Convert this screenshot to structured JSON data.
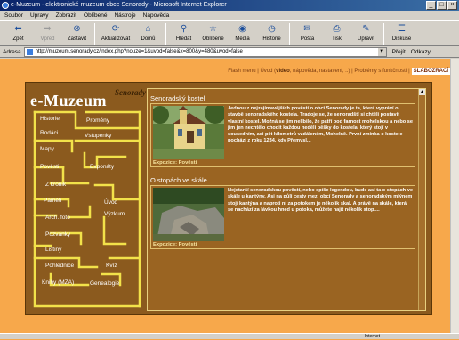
{
  "window": {
    "title": "e-Muzeum - elektronické muzeum obce Senorady - Microsoft Internet Explorer",
    "buttons": [
      "_",
      "□",
      "×"
    ]
  },
  "menu": [
    "Soubor",
    "Úpravy",
    "Zobrazit",
    "Oblíbené",
    "Nástroje",
    "Nápověda"
  ],
  "toolbar": [
    {
      "label": "Zpět",
      "icon": "back-arrow-icon",
      "glyph": "⬅",
      "enabled": true
    },
    {
      "label": "Vpřed",
      "icon": "forward-arrow-icon",
      "glyph": "➡",
      "enabled": false
    },
    {
      "label": "Zastavit",
      "icon": "stop-icon",
      "glyph": "⊗",
      "enabled": true
    },
    {
      "label": "Aktualizovat",
      "icon": "refresh-icon",
      "glyph": "⟳",
      "enabled": true
    },
    {
      "label": "Domů",
      "icon": "home-icon",
      "glyph": "⌂",
      "enabled": true
    },
    {
      "label": "Hledat",
      "icon": "search-icon",
      "glyph": "⚲",
      "enabled": true
    },
    {
      "label": "Oblíbené",
      "icon": "favorites-icon",
      "glyph": "☆",
      "enabled": true
    },
    {
      "label": "Média",
      "icon": "media-icon",
      "glyph": "◉",
      "enabled": true
    },
    {
      "label": "Historie",
      "icon": "history-icon",
      "glyph": "◷",
      "enabled": true
    },
    {
      "label": "Pošta",
      "icon": "mail-icon",
      "glyph": "✉",
      "enabled": true
    },
    {
      "label": "Tisk",
      "icon": "print-icon",
      "glyph": "⎙",
      "enabled": true
    },
    {
      "label": "Upravit",
      "icon": "edit-icon",
      "glyph": "✎",
      "enabled": true
    },
    {
      "label": "Diskuse",
      "icon": "discuss-icon",
      "glyph": "☰",
      "enabled": true
    }
  ],
  "address": {
    "label": "Adresa",
    "url": "http://muzeum.senorady.cz/index.php?nouze=1&uvod=false&x=800&y=480&uvod=false",
    "go": "Přejít",
    "links": "Odkazy"
  },
  "site": {
    "flash_menu": {
      "prefix": "Flash menu | Úvod (",
      "video": "video",
      "suffix": ", nápověda, nastavení, ..) | Problémy s funkčností |",
      "button": "SLABOZRACÍ"
    },
    "logo": "e-Muzeum",
    "logo_sub": "Senorady",
    "menu": [
      "Historie",
      "Proměny",
      "Rodáci",
      "Vstupenky",
      "Mapy",
      "Pověsti",
      "Exponáty",
      "Z kronik",
      "Paměti",
      "Úvod",
      "Arch. foto",
      "Výzkum",
      "Pozvánky",
      "Listiny",
      "Pohlednice",
      "Kvíz",
      "Knihy (MZA)",
      "Genealogie"
    ],
    "stories": [
      {
        "title": "Senoradský kostel",
        "text": "Jednou z nejzajímavějších pověstí o obci Senorady je ta, která vypráví o stavbě senoradského kostela. Tradoje se, že senoradští si chtěli postavit vlastní kostel. Možná se jim nelíbilo, že patří pod farnost mohelskou a nebo se jim jen nechtělo chodit každou neděli pěšky do kostela, který stojí v sousedním, asi pět kilometrů vzdáleném, Mohelně. První zmínka o kostele pochází z roku 1234, kdy Přemysl...",
        "exposition": "Expozice: Pověsti"
      },
      {
        "title": "O stopách ve skále..",
        "text": "Nejstarší senoradskou pověstí, nebo spíše legendou, bude asi ta o stopách ve skále u kantýny. Asi na půli cesty mezi obcí Senorady a senoradským mlýnem stojí kantýna a naproti ní za potokem je několik skal. A právě na skále, která se nachází za lávkou hned u potoka, můžete najít několik stop....",
        "exposition": "Expozice: Pověsti"
      }
    ]
  },
  "status": {
    "zone": "Internet"
  },
  "colors": {
    "page_bg": "#f7a84b",
    "site_bg": "#8b5a1e",
    "maze_line": "#f2e24a",
    "title_bar": "#0a246a"
  }
}
